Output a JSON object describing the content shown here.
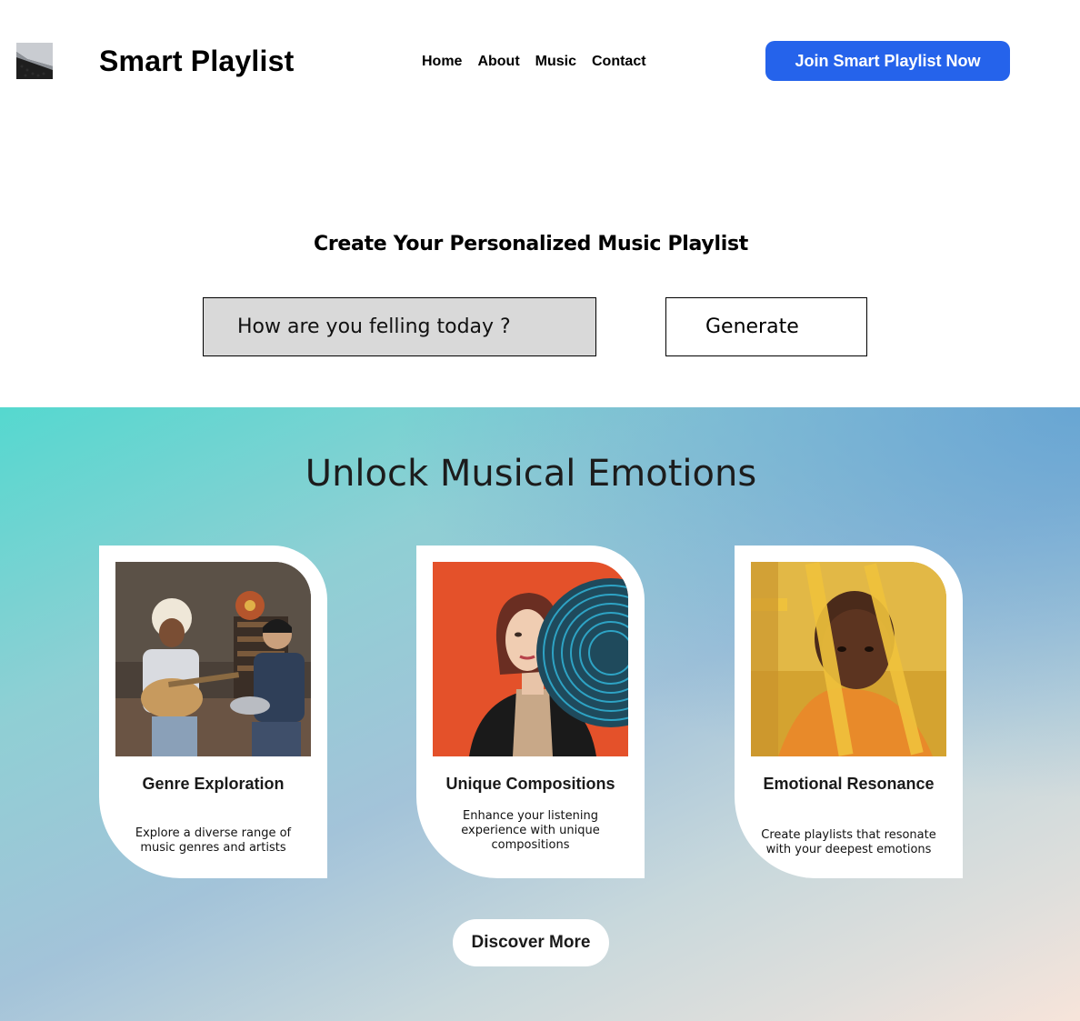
{
  "header": {
    "brand": "Smart Playlist",
    "nav": [
      "Home",
      "About",
      "Music",
      "Contact"
    ],
    "cta_label": "Join Smart Playlist Now"
  },
  "hero": {
    "title": "Create Your Personalized Music Playlist",
    "input_placeholder": "How are you felling today ?",
    "generate_label": "Generate"
  },
  "features": {
    "title": "Unlock Musical Emotions",
    "cards": [
      {
        "title": "Genre Exploration",
        "description": "Explore a diverse range of music genres and artists"
      },
      {
        "title": "Unique Compositions",
        "description": "Enhance your listening experience with unique compositions"
      },
      {
        "title": "Emotional Resonance",
        "description": "Create playlists that resonate with your deepest emotions"
      }
    ],
    "discover_label": "Discover More"
  },
  "colors": {
    "accent": "#2563eb",
    "input_bg": "#d9d9d9",
    "gradient_start": "#55d8cf",
    "gradient_end": "#f7e4da"
  }
}
